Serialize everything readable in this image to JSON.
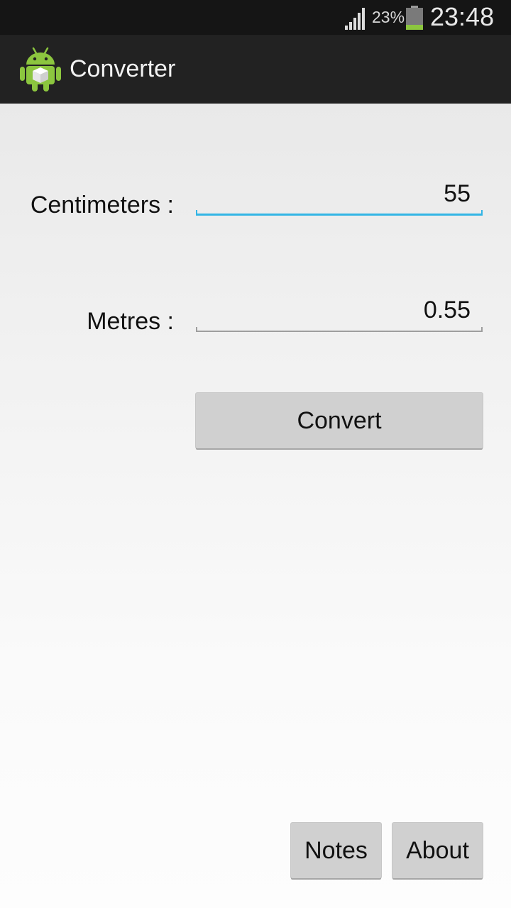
{
  "status_bar": {
    "battery_percent": "23%",
    "battery_level": 0.23,
    "signal_icon": "signal-strength-icon",
    "battery_icon": "battery-icon",
    "time": "23:48"
  },
  "action_bar": {
    "icon": "android-app-icon",
    "title": "Converter"
  },
  "form": {
    "centimeters_label": "Centimeters :",
    "centimeters_value": "55",
    "metres_label": "Metres :",
    "metres_value": "0.55",
    "convert_label": "Convert"
  },
  "footer": {
    "notes_label": "Notes",
    "about_label": "About"
  },
  "colors": {
    "focus_accent": "#33b5e5",
    "unfocused_underline": "#9e9e9e",
    "battery_green": "#8cc63f"
  }
}
